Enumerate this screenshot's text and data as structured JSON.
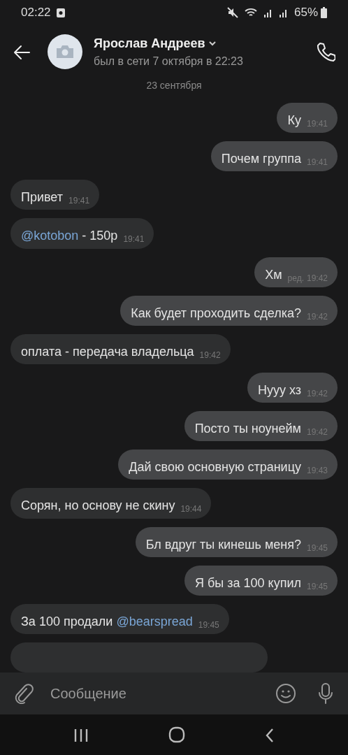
{
  "status_bar": {
    "time": "02:22",
    "battery": "65%"
  },
  "header": {
    "name": "Ярослав Андреев",
    "status": "был в сети 7 октября в 22:23"
  },
  "date_separator": "23 сентября",
  "messages": [
    {
      "outgoing": true,
      "parts": [
        {
          "kind": "text",
          "text": "Ку"
        }
      ],
      "time": "19:41"
    },
    {
      "outgoing": true,
      "parts": [
        {
          "kind": "text",
          "text": "Почем группа"
        }
      ],
      "time": "19:41"
    },
    {
      "outgoing": false,
      "parts": [
        {
          "kind": "text",
          "text": "Привет"
        }
      ],
      "time": "19:41"
    },
    {
      "outgoing": false,
      "parts": [
        {
          "kind": "mention",
          "text": "@kotobon"
        },
        {
          "kind": "text",
          "text": " - 150р"
        }
      ],
      "time": "19:41"
    },
    {
      "outgoing": true,
      "parts": [
        {
          "kind": "text",
          "text": "Хм"
        }
      ],
      "edited": "ред.",
      "time": "19:42"
    },
    {
      "outgoing": true,
      "parts": [
        {
          "kind": "text",
          "text": "Как будет проходить сделка?"
        }
      ],
      "time": "19:42"
    },
    {
      "outgoing": false,
      "parts": [
        {
          "kind": "text",
          "text": "оплата - передача владельца"
        }
      ],
      "time": "19:42"
    },
    {
      "outgoing": true,
      "parts": [
        {
          "kind": "text",
          "text": "Нууу хз"
        }
      ],
      "time": "19:42"
    },
    {
      "outgoing": true,
      "parts": [
        {
          "kind": "text",
          "text": "Посто ты ноунейм"
        }
      ],
      "time": "19:42"
    },
    {
      "outgoing": true,
      "parts": [
        {
          "kind": "text",
          "text": "Дай свою основную страницу"
        }
      ],
      "time": "19:43"
    },
    {
      "outgoing": false,
      "parts": [
        {
          "kind": "text",
          "text": "Сорян, но основу не скину"
        }
      ],
      "time": "19:44"
    },
    {
      "outgoing": true,
      "parts": [
        {
          "kind": "text",
          "text": "Бл вдруг ты кинешь меня?"
        }
      ],
      "time": "19:45"
    },
    {
      "outgoing": true,
      "parts": [
        {
          "kind": "text",
          "text": "Я бы за 100 купил"
        }
      ],
      "time": "19:45"
    },
    {
      "outgoing": false,
      "parts": [
        {
          "kind": "text",
          "text": "За 100 продали "
        },
        {
          "kind": "mention",
          "text": "@bearspread"
        }
      ],
      "time": "19:45"
    },
    {
      "outgoing": false,
      "kind": "cut"
    }
  ],
  "composer": {
    "placeholder": "Сообщение"
  }
}
